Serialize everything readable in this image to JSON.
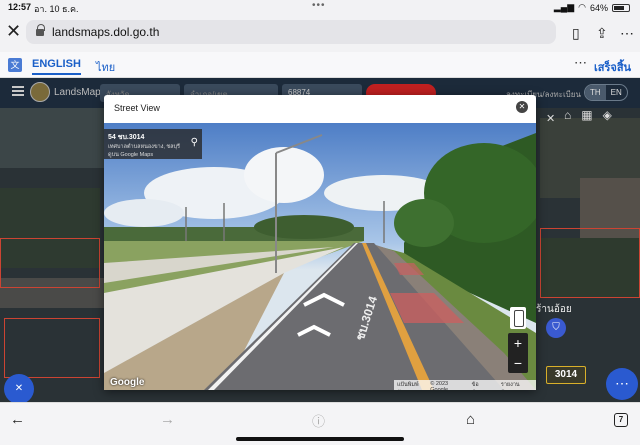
{
  "status_bar": {
    "time": "12:57",
    "date": "อา. 10 ธ.ค.",
    "battery": "64%"
  },
  "browser": {
    "url": "landsmaps.dol.go.th"
  },
  "translate_bar": {
    "english": "ENGLISH",
    "thai": "ไทย",
    "more": "⋯",
    "done": "เสร็จสิ้น"
  },
  "app": {
    "name": "LandsMaps",
    "select_1": "จังหวัด",
    "select_2": "อำเภอ/เขต",
    "parcel": "68874",
    "register": "ลงทะเบียน/ลงทะเบียน",
    "lang_th": "TH",
    "lang_en": "EN",
    "map_close": "✕",
    "shop_label": "ร้านอ้อย",
    "road_sign": "3014"
  },
  "modal": {
    "title": "Street View",
    "close": "✕"
  },
  "street_view": {
    "address": "54 ชบ.3014",
    "location": "เทศบาลตำบลหนองขาง, ชลบุรี",
    "source": "ดูบน Google Maps",
    "road_marking": "ชบ.3014",
    "zoom_in": "+",
    "zoom_out": "−",
    "logo": "Google",
    "footer": [
      "แป้นพิมพ์ลัด",
      "© 2023 Google",
      "ข้อกำหนด",
      "รายงานปัญหา"
    ]
  },
  "bottom_nav": {
    "tab_count": "7"
  },
  "colors": {
    "accent": "#1a5fc8",
    "map_bg": "#2a3236",
    "header": "#1c2a3a",
    "primary_button": "#2a5ad0"
  }
}
